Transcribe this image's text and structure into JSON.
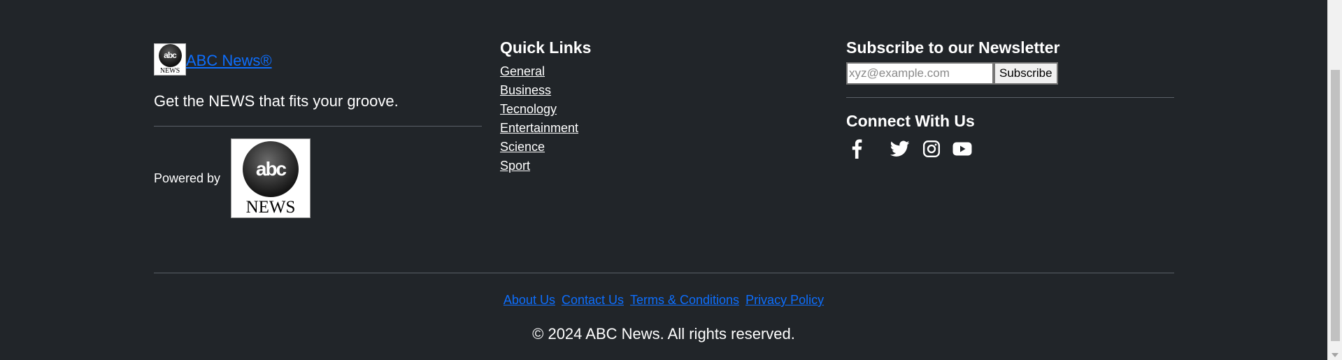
{
  "brand": {
    "name": "ABC News®",
    "tagline": "Get the NEWS that fits your groove.",
    "powered_by": "Powered by",
    "logo": {
      "disc_text": "abc",
      "word": "NEWS"
    }
  },
  "quick_links": {
    "title": "Quick Links",
    "items": [
      {
        "label": "General"
      },
      {
        "label": "Business"
      },
      {
        "label": "Tecnology"
      },
      {
        "label": "Entertainment"
      },
      {
        "label": "Science"
      },
      {
        "label": "Sport"
      }
    ]
  },
  "newsletter": {
    "title": "Subscribe to our Newsletter",
    "placeholder": "xyz@example.com",
    "value": "",
    "button_label": "Subscribe"
  },
  "connect": {
    "title": "Connect With Us",
    "icons": [
      "facebook-icon",
      "twitter-icon",
      "instagram-icon",
      "youtube-icon"
    ]
  },
  "footer": {
    "links": [
      {
        "label": "About Us"
      },
      {
        "label": "Contact Us"
      },
      {
        "label": "Terms & Conditions"
      },
      {
        "label": "Privacy Policy"
      }
    ],
    "copyright": "© 2024 ABC News. All rights reserved."
  },
  "colors": {
    "background": "#212529",
    "link_accent": "#0d6efd",
    "text": "#ffffff"
  }
}
